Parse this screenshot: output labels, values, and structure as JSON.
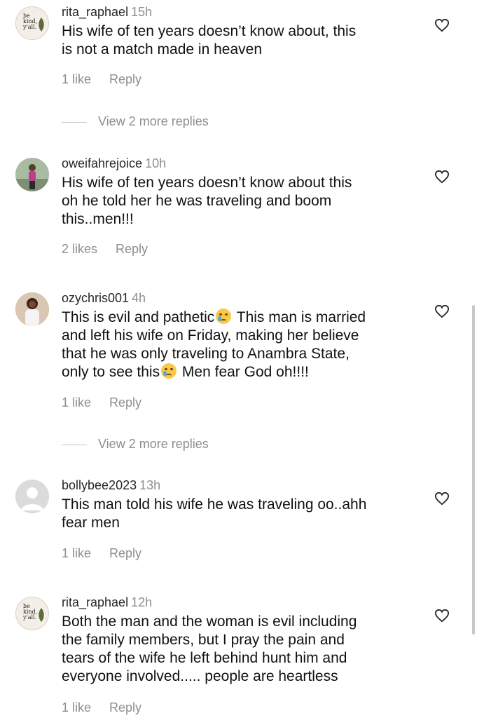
{
  "comments": [
    {
      "username": "rita_raphael",
      "time": "15h",
      "text": "His wife of ten years doesn’t know about, this\nis not a match made in heaven",
      "likes": "1 like",
      "reply": "Reply",
      "view_more": "View 2 more replies"
    },
    {
      "username": "oweifahrejoice",
      "time": "10h",
      "text": "His wife of ten years doesn’t know about this\noh he told her he was traveling and boom\nthis..men!!!",
      "likes": "2 likes",
      "reply": "Reply"
    },
    {
      "username": "ozychris001",
      "time": "4h",
      "text_parts": [
        "This is evil and pathetic",
        " This man is married\nand left his wife on Friday, making her believe\nthat he was only traveling to Anambra State,\nonly to see this",
        " Men fear God oh!!!!"
      ],
      "emoji": "crying-face-emoji",
      "likes": "1 like",
      "reply": "Reply",
      "view_more": "View 2 more replies"
    },
    {
      "username": "bollybee2023",
      "time": "13h",
      "text": "This man told his wife he was traveling oo..ahh\nfear men",
      "likes": "1 like",
      "reply": "Reply"
    },
    {
      "username": "rita_raphael",
      "time": "12h",
      "text": "Both the man and the woman is evil including\nthe family members, but I pray  the pain and\ntears of the wife he left behind hunt him and\neveryone involved..... people are heartless",
      "likes": "1 like",
      "reply": "Reply"
    }
  ],
  "avatar_logo_text": "be kind, y'all.",
  "icons": {
    "like": "heart-outline-icon"
  },
  "colors": {
    "text": "#111111",
    "muted": "#8e8e8e",
    "username": "#262626"
  }
}
